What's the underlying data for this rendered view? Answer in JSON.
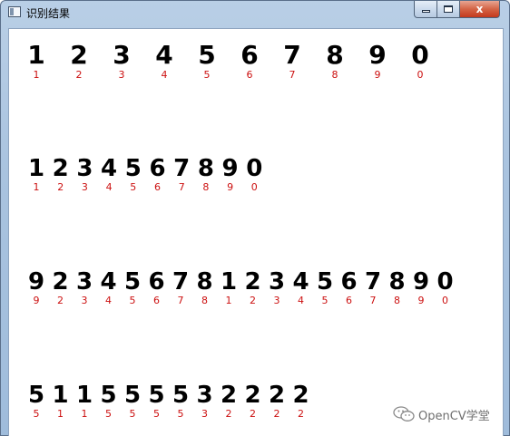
{
  "window": {
    "title": "识别结果",
    "controls": {
      "minimize": "—",
      "maximize": "□",
      "close": "x"
    }
  },
  "rows": [
    {
      "digits": [
        "1",
        "2",
        "3",
        "4",
        "5",
        "6",
        "7",
        "8",
        "9",
        "0"
      ]
    },
    {
      "digits": [
        "1",
        "2",
        "3",
        "4",
        "5",
        "6",
        "7",
        "8",
        "9",
        "0"
      ]
    },
    {
      "digits": [
        "9",
        "2",
        "3",
        "4",
        "5",
        "6",
        "7",
        "8",
        "1",
        "2",
        "3",
        "4",
        "5",
        "6",
        "7",
        "8",
        "9",
        "0"
      ]
    },
    {
      "digits": [
        "5",
        "1",
        "1",
        "5",
        "5",
        "5",
        "5",
        "3",
        "2",
        "2",
        "2",
        "2"
      ]
    }
  ],
  "watermark": {
    "text": "OpenCV学堂",
    "icon": "wechat-icon"
  },
  "colors": {
    "digit": "#000000",
    "label": "#cc1010",
    "frame": "#a9c3df",
    "close": "#c4391d"
  }
}
